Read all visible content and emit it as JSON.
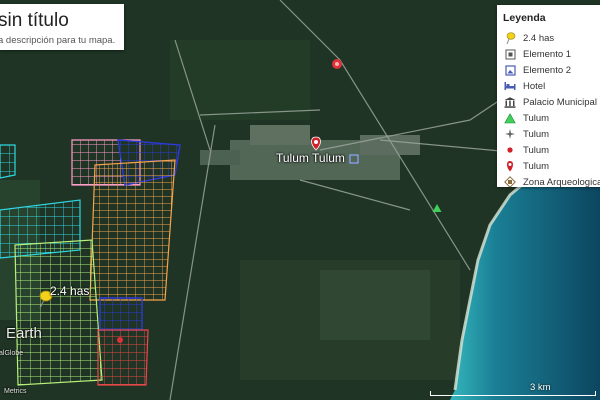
{
  "map": {
    "title": "sin título",
    "description": "a descripción para tu mapa.",
    "place_label": "Tulum Tulum",
    "pin_label": "2.4 has",
    "watermark": "Earth",
    "credit_left": "alGlobe",
    "credit_bottom": "Metrics",
    "scale_label": "3 km"
  },
  "legend": {
    "title": "Leyenda",
    "items": [
      {
        "icon": "pushpin-icon",
        "label": "2.4 has",
        "color": "#f2d21b"
      },
      {
        "icon": "square-box-icon",
        "label": "Elemento 1",
        "color": "#555555"
      },
      {
        "icon": "photo-frame-icon",
        "label": "Elemento 2",
        "color": "#4a5bb5"
      },
      {
        "icon": "hotel-bed-icon",
        "label": "Hotel",
        "color": "#4a5bb5"
      },
      {
        "icon": "columns-building-icon",
        "label": "Palacio Municipal d",
        "color": "#444444"
      },
      {
        "icon": "triangle-icon",
        "label": "Tulum",
        "color": "#3fcf5a"
      },
      {
        "icon": "windmill-icon",
        "label": "Tulum",
        "color": "#666666"
      },
      {
        "icon": "red-dot-icon",
        "label": "Tulum",
        "color": "#d0202a"
      },
      {
        "icon": "red-pin-icon",
        "label": "Tulum",
        "color": "#d0202a"
      },
      {
        "icon": "ruins-icon",
        "label": "Zona Arqueologica",
        "color": "#8a6a3a"
      }
    ]
  },
  "colors": {
    "forest": "#203524",
    "sea_deep": "#0d4a63",
    "sea_shallow": "#2fa3b0",
    "parcel_pink": "#ff9ec6",
    "parcel_orange": "#f5a44a",
    "parcel_blue": "#2c3ad6",
    "parcel_cyan": "#2fd7e3",
    "parcel_lightgreen": "#b6f07a",
    "parcel_red": "#e03030"
  }
}
